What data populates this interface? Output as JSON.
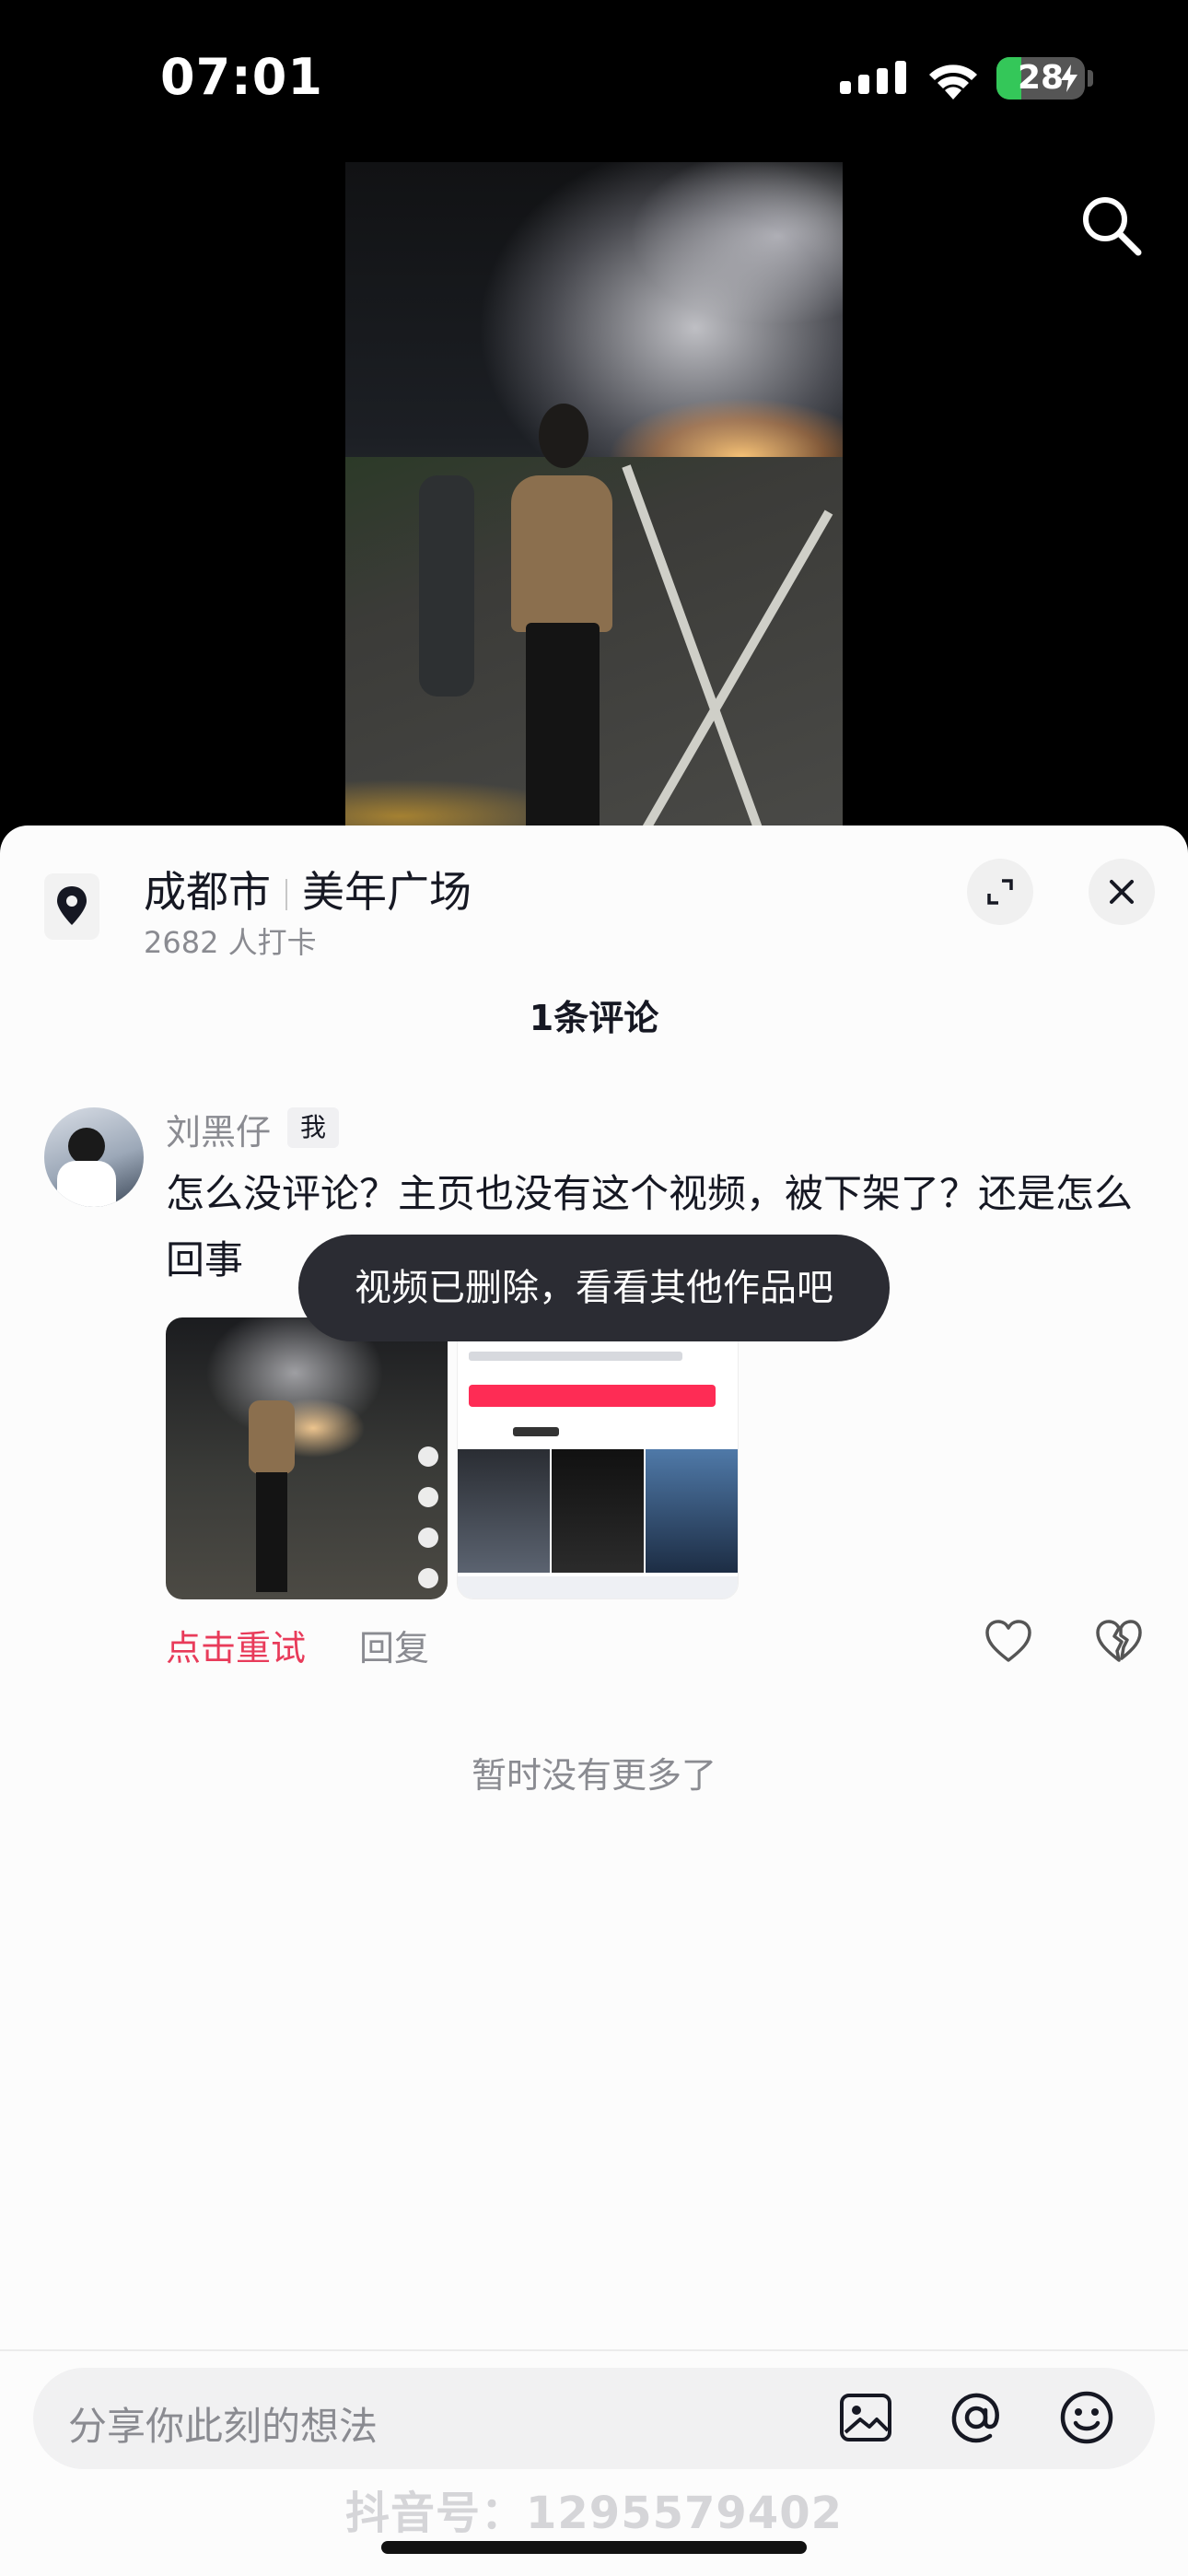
{
  "status_bar": {
    "time": "07:01",
    "battery_level": "28",
    "battery_charging": true
  },
  "video": {
    "search_icon": "search-icon"
  },
  "location": {
    "icon": "location-pin-icon",
    "city": "成都市",
    "place": "美年广场",
    "checkins": "2682 人打卡"
  },
  "sheet": {
    "expand_icon": "expand-icon",
    "close_icon": "close-icon",
    "comment_count": "1条评论",
    "no_more": "暂时没有更多了"
  },
  "comment": {
    "username": "刘黑仔",
    "badge": "我",
    "text": "怎么没评论？主页也没有这个视频，被下架了？还是怎么回事",
    "retry": "点击重试",
    "reply": "回复",
    "like_icon": "heart-icon",
    "dislike_icon": "broken-heart-icon"
  },
  "toast": {
    "message": "视频已删除，看看其他作品吧"
  },
  "input_bar": {
    "placeholder": "分享你此刻的想法",
    "icons": [
      "image-icon",
      "at-icon",
      "emoji-icon"
    ]
  },
  "watermark": "抖音号：1295579402",
  "colors": {
    "accent_red": "#e83b5a",
    "follow_red": "#fe2c55",
    "toast_bg": "#2b2c33",
    "battery_green": "#34c759"
  }
}
